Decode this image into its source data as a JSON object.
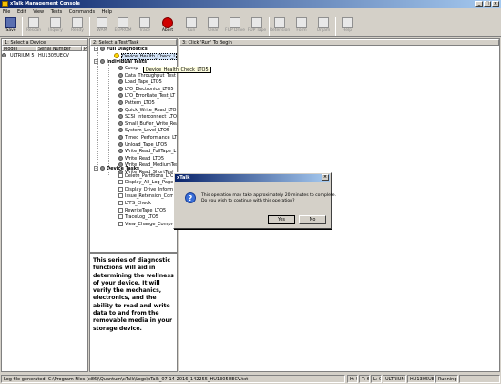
{
  "window": {
    "title": "xTalk Management Console"
  },
  "menu": [
    "File",
    "Edit",
    "View",
    "Tests",
    "Commands",
    "Help"
  ],
  "toolbar": [
    {
      "label": "Save",
      "icon": "save-icon",
      "enabled": true
    },
    {
      "label": "Rescan",
      "icon": "rescan-icon",
      "enabled": false
    },
    {
      "label": "Inquiry",
      "icon": "inquiry-icon",
      "enabled": false
    },
    {
      "label": "Ready",
      "icon": "ready-icon",
      "enabled": false
    },
    {
      "label": "WAM",
      "icon": "wam-icon",
      "enabled": false
    },
    {
      "label": "EEPROM",
      "icon": "eeprom-icon",
      "enabled": false
    },
    {
      "label": "Trace",
      "icon": "trace-icon",
      "enabled": false
    },
    {
      "label": "Abort",
      "icon": "abort-icon",
      "enabled": true
    },
    {
      "label": "Run",
      "icon": "run-icon",
      "enabled": false
    },
    {
      "label": "Clear",
      "icon": "clear-icon",
      "enabled": false
    },
    {
      "label": "FUP Drive",
      "icon": "fup-drive-icon",
      "enabled": false
    },
    {
      "label": "FUP Tape",
      "icon": "fup-tape-icon",
      "enabled": false
    },
    {
      "label": "Retension",
      "icon": "retension-icon",
      "enabled": false
    },
    {
      "label": "Form",
      "icon": "form-icon",
      "enabled": false
    },
    {
      "label": "Unjam",
      "icon": "unjam-icon",
      "enabled": false
    },
    {
      "label": "Help",
      "icon": "help-icon",
      "enabled": false
    }
  ],
  "panes": {
    "device": "1: Select a Device",
    "test": "2: Select a Test/Task",
    "run": "3: Click 'Run' To Begin"
  },
  "device_grid": {
    "columns": [
      "Model",
      "Serial Number",
      "P"
    ],
    "row": {
      "model": "ULTRIUM 5",
      "serial": "HU1305UECV"
    }
  },
  "tree": {
    "full_diagnostics": "Full Diagnostics",
    "selected_test": "Device_Health_Check_L",
    "individual_tests": "Individual Tests",
    "tests": [
      "Comp",
      "Data_Throughput_Test_L",
      "Load_Tape_LTO5",
      "LTO_Electronics_LTO5",
      "LTO_ErrorRate_Test_LT",
      "Pattern_LTO5",
      "Quick_Write_Read_LTO",
      "SCSI_Interconnect_LTO",
      "Small_Buffer_Write_Rea",
      "System_Level_LTO5",
      "Timed_Performance_LT",
      "Unload_Tape_LTO5",
      "Write_Read_FullTape_L",
      "Write_Read_LTO5",
      "Write_Read_MediumTest",
      "Write_Read_ShortTest_"
    ],
    "device_tasks": "Device Tasks",
    "tasks": [
      "Delete_Partitions_LTO",
      "Display_All_Log_Pages",
      "Display_Drive_Informa",
      "Issue_Retension_Com",
      "LTFS_Check",
      "RewriteTape_LTO5",
      "TraceLog_LTO5",
      "View_Change_Compre"
    ]
  },
  "tooltip": "Device_Health_Check_LTO5",
  "description": "This series of diagnostic functions will aid in determining the wellness of your device. It will verify the mechanics, electronics, and the ability to read and write data to and from the removable media in your storage device.",
  "dialog": {
    "title": "xTalk",
    "line1": "This operation may take approximately 20 minutes to complete.",
    "line2": "Do you wish to continue with this operation?",
    "yes": "Yes",
    "no": "No"
  },
  "status": {
    "log": "Log file generated: C:\\Program Files (x86)\\Quantum\\xTalk\\Logs\\xTalk_07-14-2016_142255_HU1305UECV.txt",
    "h": "H: 5",
    "t": "T: 6",
    "l": "L: 0",
    "model": "ULTRIUM 5",
    "serial": "HU1305UECV",
    "state": "Running"
  }
}
